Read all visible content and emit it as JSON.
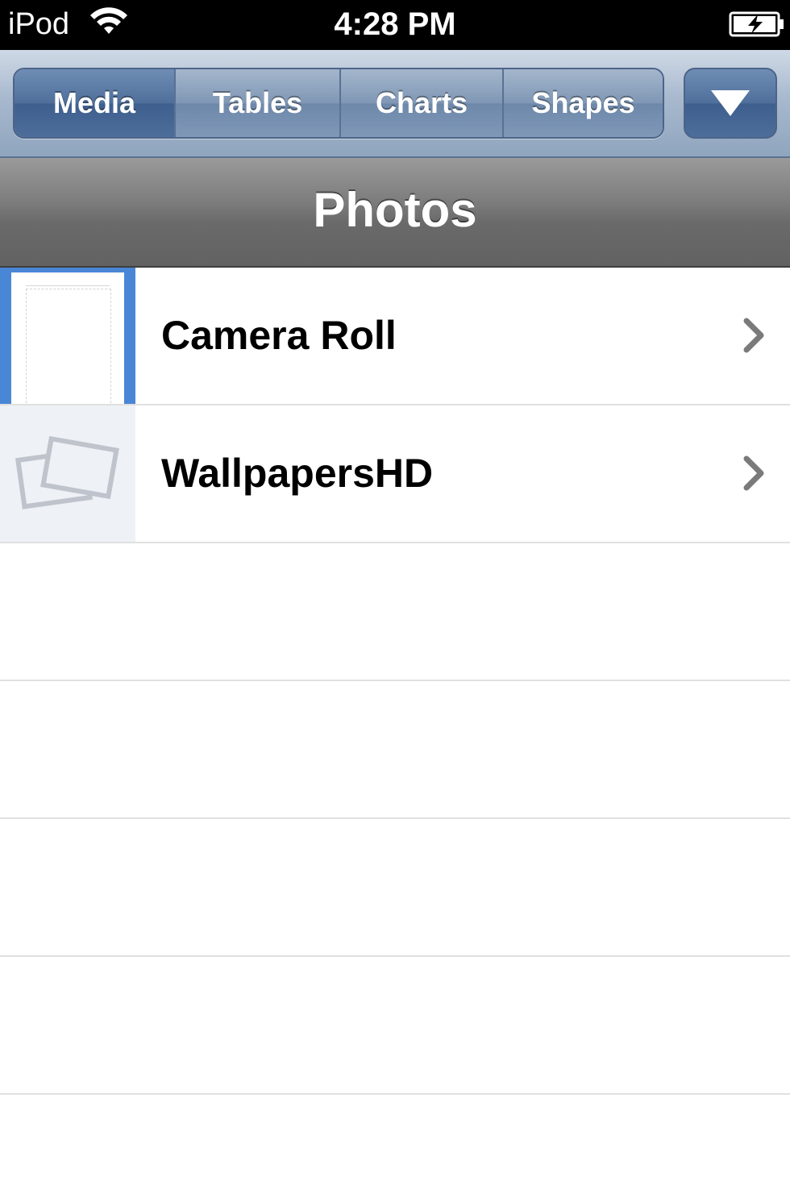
{
  "status_bar": {
    "carrier": "iPod",
    "time": "4:28 PM",
    "wifi_icon": "wifi-icon",
    "battery_icon": "battery-charging-icon"
  },
  "toolbar": {
    "segments": [
      {
        "label": "Media",
        "selected": true
      },
      {
        "label": "Tables",
        "selected": false
      },
      {
        "label": "Charts",
        "selected": false
      },
      {
        "label": "Shapes",
        "selected": false
      }
    ],
    "dropdown_icon": "triangle-down-icon"
  },
  "navbar": {
    "title": "Photos"
  },
  "albums": [
    {
      "name": "Camera Roll",
      "thumbnail": "document-thumbnail",
      "accessory_icon": "chevron-right-icon"
    },
    {
      "name": "WallpapersHD",
      "thumbnail": "photo-placeholder-icon",
      "accessory_icon": "chevron-right-icon"
    }
  ],
  "colors": {
    "toolbar_accent": "#4f6f9b",
    "navbar": "#6a6a6a",
    "status_bar": "#000000"
  }
}
